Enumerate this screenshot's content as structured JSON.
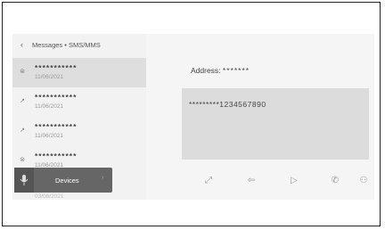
{
  "header": {
    "back_glyph": "‹",
    "breadcrumb": "Messages • SMS/MMS"
  },
  "messages": [
    {
      "name": "***********",
      "date": "11/06/2021",
      "icon": "inbox-icon",
      "glyph": "⊜",
      "selected": true
    },
    {
      "name": "***********",
      "date": "11/06/2021",
      "icon": "outgoing-arrow-icon",
      "glyph": "↗",
      "selected": false
    },
    {
      "name": "***********",
      "date": "11/06/2021",
      "icon": "outgoing-arrow-icon",
      "glyph": "↗",
      "selected": false
    },
    {
      "name": "***********",
      "date": "11/06/2021",
      "icon": "inbox-icon",
      "glyph": "⊜",
      "selected": false
    }
  ],
  "partial_row_date": "03/06/2021",
  "devices": {
    "label": "Devices",
    "mic_icon": "microphone-icon",
    "chevron": "›"
  },
  "detail": {
    "address_label": "Address:",
    "address_value": "*******",
    "message_text": "*********1234567890"
  },
  "toolbar": [
    {
      "icon": "expand-icon",
      "glyph": "⤢"
    },
    {
      "icon": "reply-icon",
      "glyph": "⇦"
    },
    {
      "icon": "play-icon",
      "glyph": "▷"
    },
    {
      "icon": "phone-icon",
      "glyph": "✆"
    },
    {
      "icon": "contact-icon",
      "glyph": "⚇"
    }
  ],
  "colors": {
    "screen_bg": "#f7f7f7",
    "selected_row": "#dedede",
    "devices_bg": "#666666",
    "message_box": "#dcdcdc"
  }
}
